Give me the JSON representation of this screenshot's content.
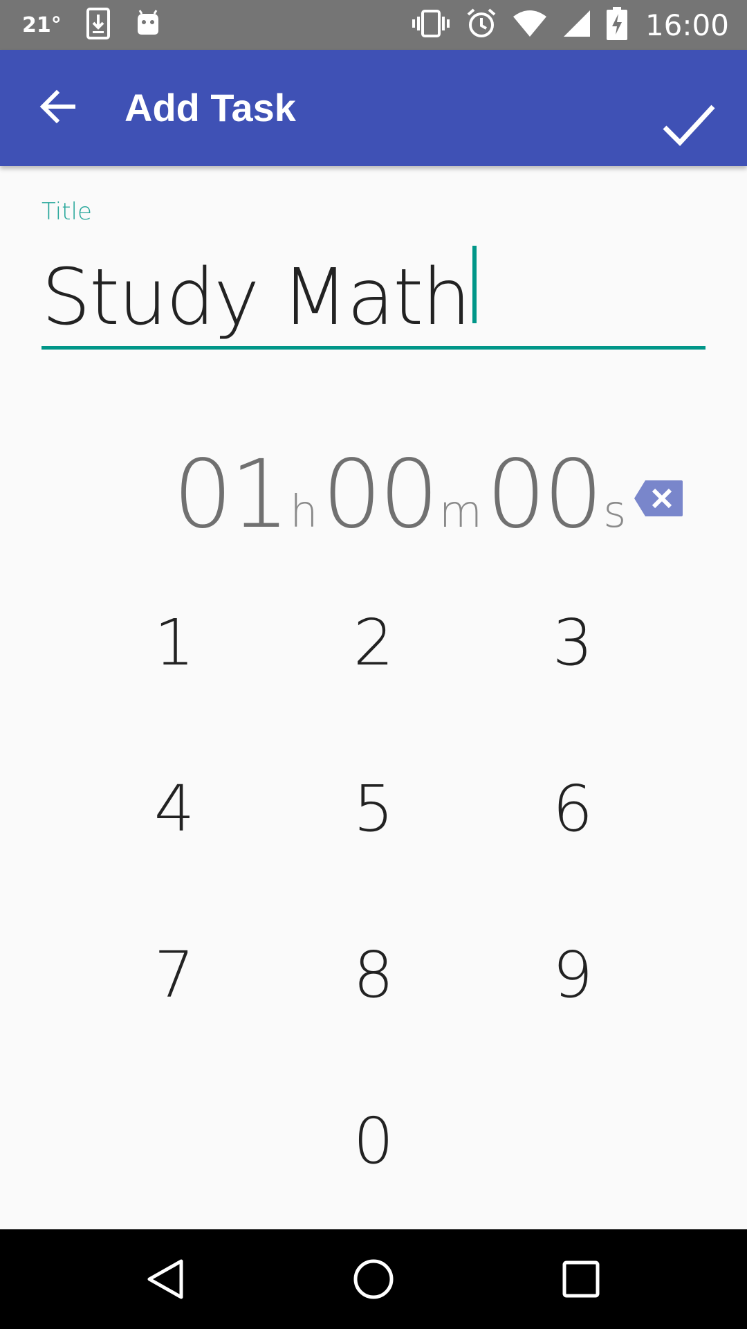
{
  "status_bar": {
    "temperature": "21°",
    "time": "16:00",
    "icons": [
      "download-icon",
      "android-icon",
      "vibrate-icon",
      "alarm-icon",
      "wifi-icon",
      "signal-icon",
      "battery-charging-icon"
    ]
  },
  "app_bar": {
    "title": "Add Task",
    "back_icon": "arrow-back-icon",
    "done_icon": "check-icon",
    "color": "#3f51b5"
  },
  "form": {
    "title_label": "Title",
    "title_value": "Study Math",
    "accent_color": "#009688"
  },
  "duration": {
    "hours": "01",
    "hours_unit": "h",
    "minutes": "00",
    "minutes_unit": "m",
    "seconds": "00",
    "seconds_unit": "s",
    "backspace_icon": "backspace-icon"
  },
  "keypad": {
    "keys": [
      "1",
      "2",
      "3",
      "4",
      "5",
      "6",
      "7",
      "8",
      "9",
      "0"
    ]
  },
  "nav_bar": {
    "icons": [
      "nav-back-icon",
      "nav-home-icon",
      "nav-recents-icon"
    ]
  }
}
